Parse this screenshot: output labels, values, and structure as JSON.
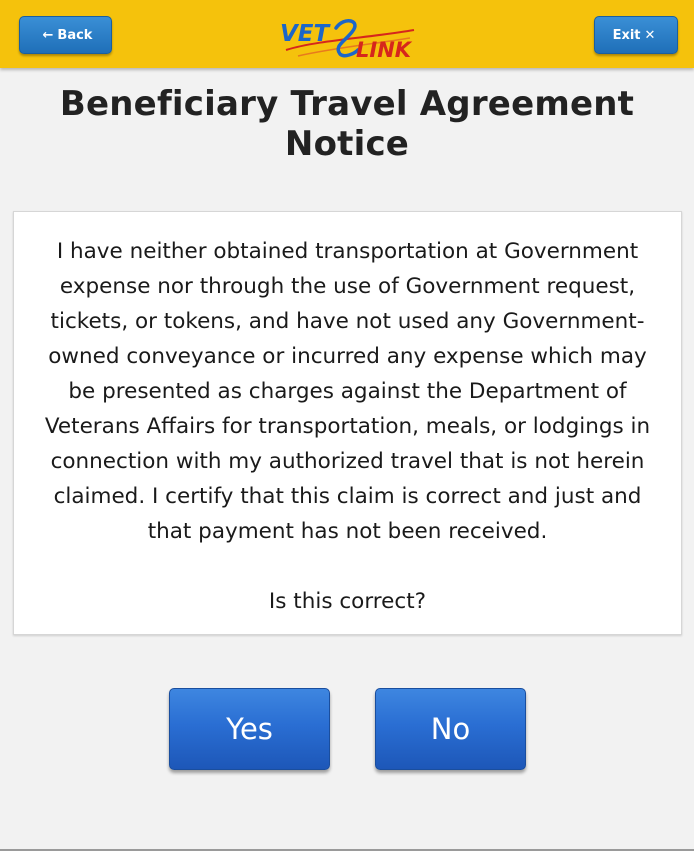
{
  "header": {
    "back_label": "Back",
    "back_icon": "arrow-left-icon",
    "exit_label": "Exit",
    "exit_icon": "close-icon",
    "logo": {
      "text_left": "VET",
      "text_right": "LINK",
      "colors": {
        "primary": "#1b66c9",
        "accent": "#d6261c"
      }
    },
    "bar_color": "#f5c20c"
  },
  "page": {
    "title": "Beneficiary Travel Agreement Notice"
  },
  "notice": {
    "body": "I have neither obtained transportation at Government expense nor through the use of Government request, tickets, or tokens, and have not used any Government-owned conveyance or incurred any expense which may be presented as charges against the Department of Veterans Affairs for transportation, meals, or lodgings in connection with my authorized travel that is not herein claimed. I certify that this claim is correct and just and that payment has not been received.",
    "question": "Is this correct?"
  },
  "answers": {
    "yes_label": "Yes",
    "no_label": "No",
    "color": "#2a6ed3"
  }
}
